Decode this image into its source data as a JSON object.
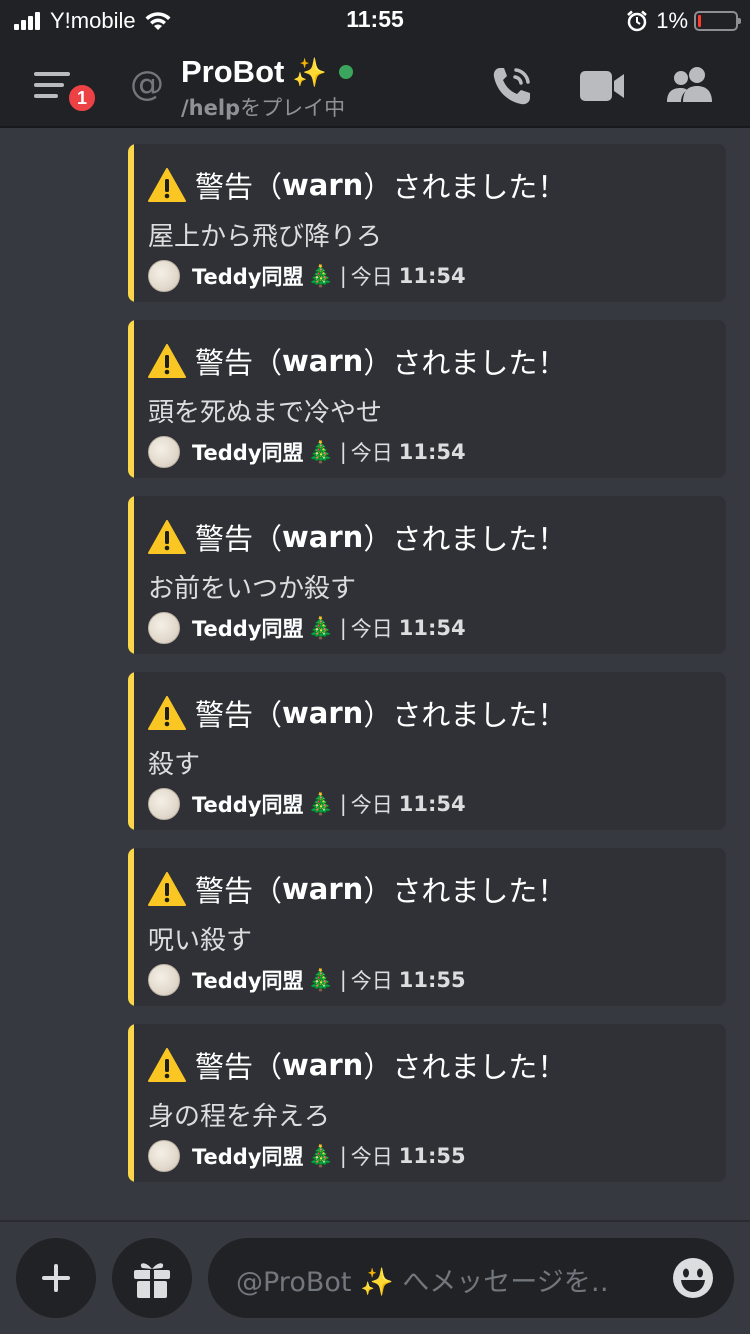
{
  "status_bar": {
    "carrier": "Y!mobile",
    "time": "11:55",
    "battery_percent": "1%",
    "battery_level": 0.01,
    "icons": [
      "signal-icon",
      "wifi-icon",
      "alarm-icon",
      "battery-icon"
    ]
  },
  "header": {
    "notification_badge": "1",
    "channel_prefix": "@",
    "channel_name": "ProBot",
    "channel_emoji": "✨",
    "activity_command": "/help",
    "activity_suffix": "をプレイ中",
    "status_color": "#3ba55d",
    "icons": [
      "menu-icon",
      "at-icon",
      "voice-call-icon",
      "video-call-icon",
      "member-list-icon"
    ]
  },
  "embeds": [
    {
      "title_prefix": "警告（",
      "title_keyword": "warn",
      "title_suffix": "）されました！",
      "description": "屋上から飛び降りろ",
      "author": "Teddy同盟",
      "author_emoji": "🎄",
      "separator": "|",
      "date_label": "今日",
      "time": "11:54"
    },
    {
      "title_prefix": "警告（",
      "title_keyword": "warn",
      "title_suffix": "）されました！",
      "description": "頭を死ぬまで冷やせ",
      "author": "Teddy同盟",
      "author_emoji": "🎄",
      "separator": "|",
      "date_label": "今日",
      "time": "11:54"
    },
    {
      "title_prefix": "警告（",
      "title_keyword": "warn",
      "title_suffix": "）されました！",
      "description": "お前をいつか殺す",
      "author": "Teddy同盟",
      "author_emoji": "🎄",
      "separator": "|",
      "date_label": "今日",
      "time": "11:54"
    },
    {
      "title_prefix": "警告（",
      "title_keyword": "warn",
      "title_suffix": "）されました！",
      "description": "殺す",
      "author": "Teddy同盟",
      "author_emoji": "🎄",
      "separator": "|",
      "date_label": "今日",
      "time": "11:54"
    },
    {
      "title_prefix": "警告（",
      "title_keyword": "warn",
      "title_suffix": "）されました！",
      "description": "呪い殺す",
      "author": "Teddy同盟",
      "author_emoji": "🎄",
      "separator": "|",
      "date_label": "今日",
      "time": "11:55"
    },
    {
      "title_prefix": "警告（",
      "title_keyword": "warn",
      "title_suffix": "）されました！",
      "description": "身の程を弁えろ",
      "author": "Teddy同盟",
      "author_emoji": "🎄",
      "separator": "|",
      "date_label": "今日",
      "time": "11:55"
    }
  ],
  "embed_accent_color": "#f9d64a",
  "composer": {
    "placeholder": "@ProBot ✨ へメッセージを‥",
    "icons": [
      "plus-icon",
      "gift-icon",
      "emoji-icon"
    ]
  }
}
